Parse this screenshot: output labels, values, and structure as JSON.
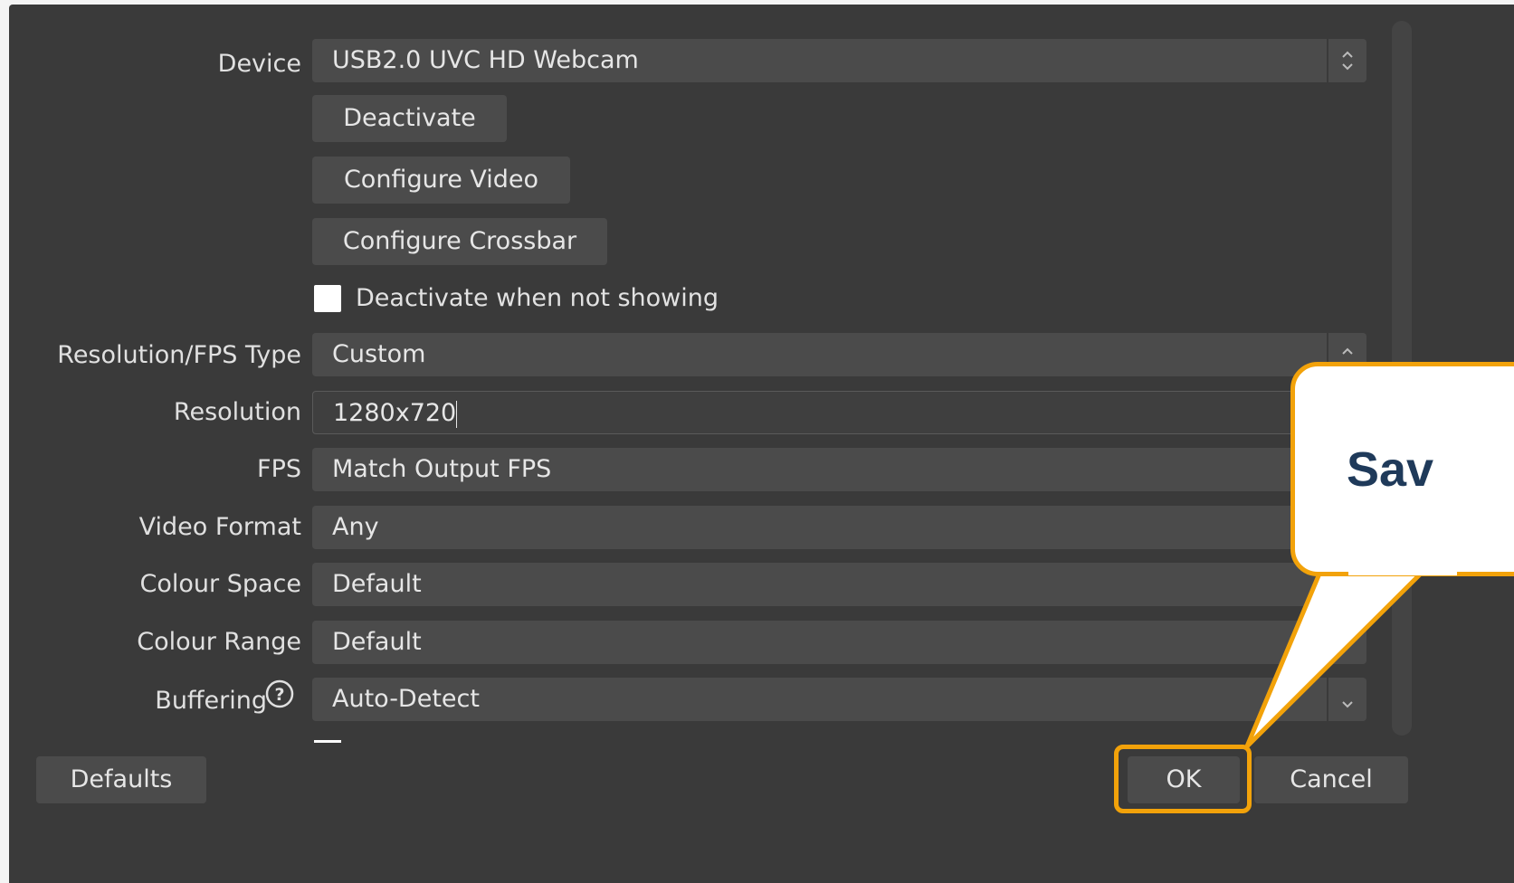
{
  "form": {
    "device": {
      "label": "Device",
      "value": "USB2.0 UVC HD Webcam"
    },
    "buttons": {
      "deactivate": "Deactivate",
      "configure_video": "Configure Video",
      "configure_crossbar": "Configure Crossbar"
    },
    "deactivate_when_not_showing": {
      "label": "Deactivate when not showing",
      "checked": false
    },
    "resolution_fps_type": {
      "label": "Resolution/FPS Type",
      "value": "Custom"
    },
    "resolution": {
      "label": "Resolution",
      "value": "1280x720"
    },
    "fps": {
      "label": "FPS",
      "value": "Match Output FPS"
    },
    "video_format": {
      "label": "Video Format",
      "value": "Any"
    },
    "colour_space": {
      "label": "Colour Space",
      "value": "Default"
    },
    "colour_range": {
      "label": "Colour Range",
      "value": "Default"
    },
    "buffering": {
      "label": "Buffering",
      "value": "Auto-Detect",
      "help_icon": "question-circle-icon"
    }
  },
  "footer": {
    "defaults": "Defaults",
    "ok": "OK",
    "cancel": "Cancel"
  },
  "annotation": {
    "callout_text": "Sav",
    "accent_color": "#f2a20a",
    "text_color": "#1f3a5a"
  },
  "colors": {
    "dialog_bg": "#3a3a3a",
    "field_bg": "#4b4b4b"
  }
}
